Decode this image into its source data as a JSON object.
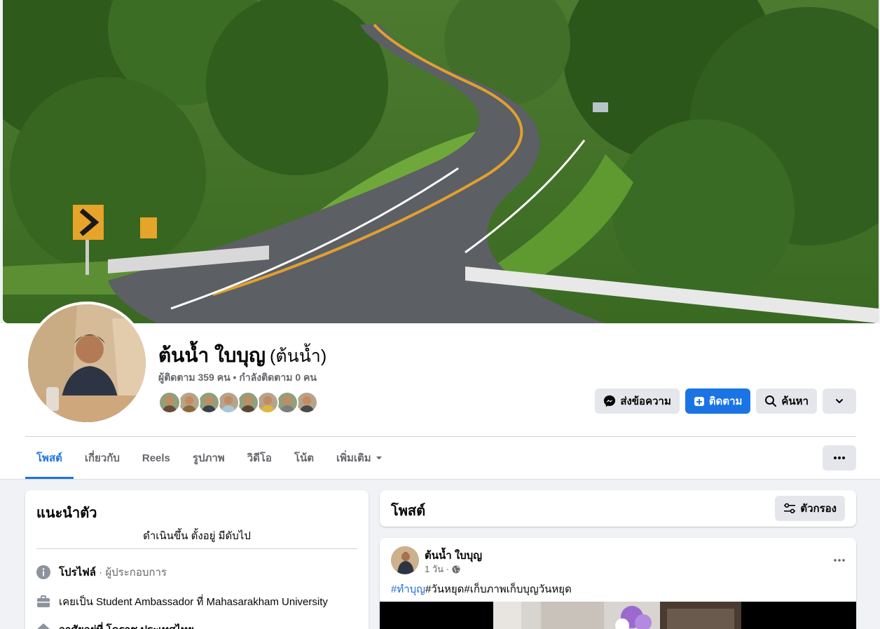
{
  "profile": {
    "name": "ต้นน้ำ ใบบุญ",
    "alt_name": "(ต้นน้ำ)",
    "stats": "ผู้ติดตาม 359 คน • กำลังติดตาม 0 คน",
    "friend_avatar_colors": [
      "#6b4a3a",
      "#8a6a3c",
      "#3d3f4a",
      "#a9c7d8",
      "#5b4636",
      "#e0b63a",
      "#7d7d7d",
      "#4a4a4a"
    ]
  },
  "actions": {
    "message_label": "ส่งข้อความ",
    "follow_label": "ติดตาม",
    "search_label": "ค้นหา"
  },
  "tabs": [
    {
      "label": "โพสต์",
      "active": true
    },
    {
      "label": "เกี่ยวกับ"
    },
    {
      "label": "Reels"
    },
    {
      "label": "รูปภาพ"
    },
    {
      "label": "วิดีโอ"
    },
    {
      "label": "โน้ต"
    },
    {
      "label": "เพิ่มเติม",
      "has_dropdown": true
    }
  ],
  "intro": {
    "title": "แนะนำตัว",
    "bio": "ดำเนินขึ้น ตั้งอยู่ มีดับไป",
    "profile_label": "โปรไฟล์",
    "profile_category": " · ผู้ประกอบการ",
    "work": "เคยเป็น Student Ambassador ที่ Mahasarakham University",
    "location": "อาศัยอยู่ที่ โคราช ประเทศไทย"
  },
  "posts_section": {
    "title": "โพสต์",
    "filter_label": "ตัวกรอง"
  },
  "post": {
    "author": "ต้นน้ำ ใบบุญ",
    "time": "1 วัน ·",
    "tag1": "#ทำบุญ",
    "rest": "#วันหยุด#เก็บภาพเก็บบุญวันหยุด"
  },
  "colors": {
    "accent": "#1b74e4",
    "background": "#f0f2f5",
    "secondary_text": "#65676b"
  }
}
